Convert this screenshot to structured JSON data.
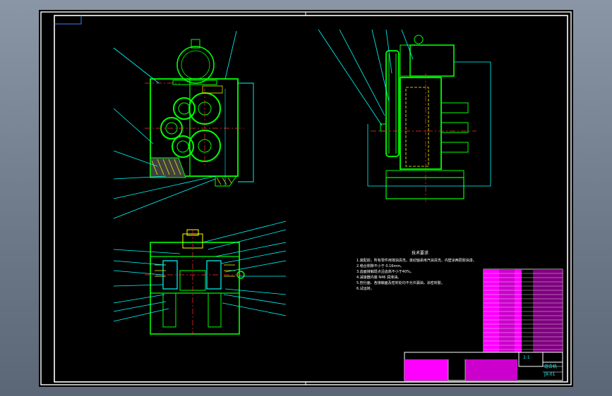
{
  "app": {
    "title": ""
  },
  "drawing": {
    "technical_requirements_title": "技术要求",
    "technical_requirements": [
      "1.装配前，所有零件用煤油清洗，滚动轴承用汽油清洗，内壁涂两层耐油漆。",
      "2.啮合侧隙不小于 0.16mm。",
      "3.齿面接触斑点沿齿高不小于40%。",
      "4.减速器内装 N46 润滑油。",
      "5.剖分面、各接触面及密封处均不允许漏油，涂密封胶。",
      "6.试运转。"
    ],
    "title_block": {
      "name": "组合机",
      "drawing_no": "JX-01",
      "scale": "1:1"
    },
    "colors": {
      "background": "#000000",
      "outline": "#00ff00",
      "leader": "#00ffff",
      "centerline": "#ff3030",
      "frame": "#ffffff",
      "table": "#ff00ff",
      "hatch": "#ffff00"
    }
  }
}
